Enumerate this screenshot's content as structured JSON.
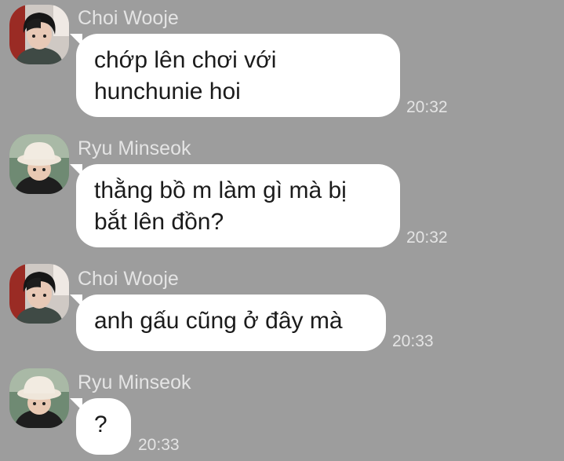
{
  "messages": [
    {
      "sender": "Choi Wooje",
      "avatar_icon": "profile-photo-dark-hair",
      "lines": [
        "chớp lên chơi với",
        "hunchunie hoi"
      ],
      "time": "20:32"
    },
    {
      "sender": "Ryu Minseok",
      "avatar_icon": "profile-photo-bucket-hat",
      "lines": [
        "thằng bồ m làm gì mà bị",
        "bắt lên đồn?"
      ],
      "time": "20:32"
    },
    {
      "sender": "Choi Wooje",
      "avatar_icon": "profile-photo-dark-hair",
      "lines": [
        "anh gấu cũng ở đây mà"
      ],
      "time": "20:33"
    },
    {
      "sender": "Ryu Minseok",
      "avatar_icon": "profile-photo-bucket-hat",
      "lines": [
        "?"
      ],
      "time": "20:33"
    }
  ],
  "colors": {
    "background": "#9d9d9d",
    "bubble": "#ffffff",
    "meta_text": "#e4e4e4"
  }
}
